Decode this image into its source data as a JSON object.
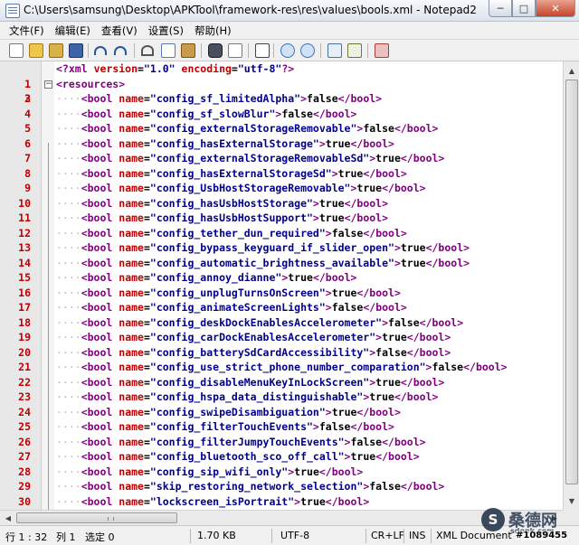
{
  "window": {
    "title": "C:\\Users\\samsung\\Desktop\\APKTool\\framework-res\\res\\values\\bools.xml - Notepad2",
    "controls": {
      "minimize": "─",
      "maximize": "□",
      "close": "✕"
    }
  },
  "menu": [
    "文件(F)",
    "编辑(E)",
    "查看(V)",
    "设置(S)",
    "帮助(H)"
  ],
  "toolbar": [
    {
      "name": "new-icon"
    },
    {
      "name": "open-icon"
    },
    {
      "name": "browse-icon"
    },
    {
      "name": "save-icon"
    },
    {
      "name": "undo-icon"
    },
    {
      "name": "redo-icon"
    },
    {
      "name": "cut-icon"
    },
    {
      "name": "copy-icon"
    },
    {
      "name": "paste-icon"
    },
    {
      "name": "find-icon"
    },
    {
      "name": "replace-icon"
    },
    {
      "name": "goto-icon"
    },
    {
      "name": "zoom-in-icon"
    },
    {
      "name": "zoom-out-icon"
    },
    {
      "name": "word-wrap-icon"
    },
    {
      "name": "scheme-icon"
    },
    {
      "name": "exit-icon"
    }
  ],
  "editor": {
    "line_numbers": [
      "1",
      "2",
      "3",
      "4",
      "5",
      "6",
      "7",
      "8",
      "9",
      "10",
      "11",
      "12",
      "13",
      "14",
      "15",
      "16",
      "17",
      "18",
      "19",
      "20",
      "21",
      "22",
      "23",
      "24",
      "25",
      "26",
      "27",
      "28",
      "29",
      "30"
    ],
    "xml_declaration": {
      "open": "<?xml",
      "version_attr": "version",
      "version_val": "\"1.0\"",
      "encoding_attr": "encoding",
      "encoding_val": "\"utf-8\"",
      "close": "?>"
    },
    "root_open": "<resources>",
    "indent": "····",
    "tag_open": "<bool",
    "name_attr": "name",
    "tag_close": "</bool>",
    "bools": [
      {
        "name": "\"config_sf_limitedAlpha\"",
        "value": "false"
      },
      {
        "name": "\"config_sf_slowBlur\"",
        "value": "false"
      },
      {
        "name": "\"config_externalStorageRemovable\"",
        "value": "false"
      },
      {
        "name": "\"config_hasExternalStorage\"",
        "value": "true"
      },
      {
        "name": "\"config_externalStorageRemovableSd\"",
        "value": "true"
      },
      {
        "name": "\"config_hasExternalStorageSd\"",
        "value": "true"
      },
      {
        "name": "\"config_UsbHostStorageRemovable\"",
        "value": "true"
      },
      {
        "name": "\"config_hasUsbHostStorage\"",
        "value": "true"
      },
      {
        "name": "\"config_hasUsbHostSupport\"",
        "value": "true"
      },
      {
        "name": "\"config_tether_dun_required\"",
        "value": "false"
      },
      {
        "name": "\"config_bypass_keyguard_if_slider_open\"",
        "value": "true"
      },
      {
        "name": "\"config_automatic_brightness_available\"",
        "value": "true"
      },
      {
        "name": "\"config_annoy_dianne\"",
        "value": "true"
      },
      {
        "name": "\"config_unplugTurnsOnScreen\"",
        "value": "true"
      },
      {
        "name": "\"config_animateScreenLights\"",
        "value": "false"
      },
      {
        "name": "\"config_deskDockEnablesAccelerometer\"",
        "value": "false"
      },
      {
        "name": "\"config_carDockEnablesAccelerometer\"",
        "value": "true"
      },
      {
        "name": "\"config_batterySdCardAccessibility\"",
        "value": "false"
      },
      {
        "name": "\"config_use_strict_phone_number_comparation\"",
        "value": "false"
      },
      {
        "name": "\"config_disableMenuKeyInLockScreen\"",
        "value": "true"
      },
      {
        "name": "\"config_hspa_data_distinguishable\"",
        "value": "true"
      },
      {
        "name": "\"config_swipeDisambiguation\"",
        "value": "true"
      },
      {
        "name": "\"config_filterTouchEvents\"",
        "value": "false"
      },
      {
        "name": "\"config_filterJumpyTouchEvents\"",
        "value": "false"
      },
      {
        "name": "\"config_bluetooth_sco_off_call\"",
        "value": "true"
      },
      {
        "name": "\"config_sip_wifi_only\"",
        "value": "true"
      },
      {
        "name": "\"skip_restoring_network_selection\"",
        "value": "false"
      },
      {
        "name": "\"lockscreen_isPortrait\"",
        "value": "true"
      }
    ]
  },
  "status": {
    "position": "行 1 : 32",
    "column": "列 1",
    "selection": "选定 0",
    "size": "1.70 KB",
    "encoding": "UTF-8",
    "line_endings": "CR+LF",
    "insert_mode": "INS",
    "scheme": "XML Document"
  },
  "watermark": {
    "logo_letter": "S",
    "site_name": "桑德网",
    "site_url": "sdonk.com",
    "image_id": "#1089455"
  }
}
